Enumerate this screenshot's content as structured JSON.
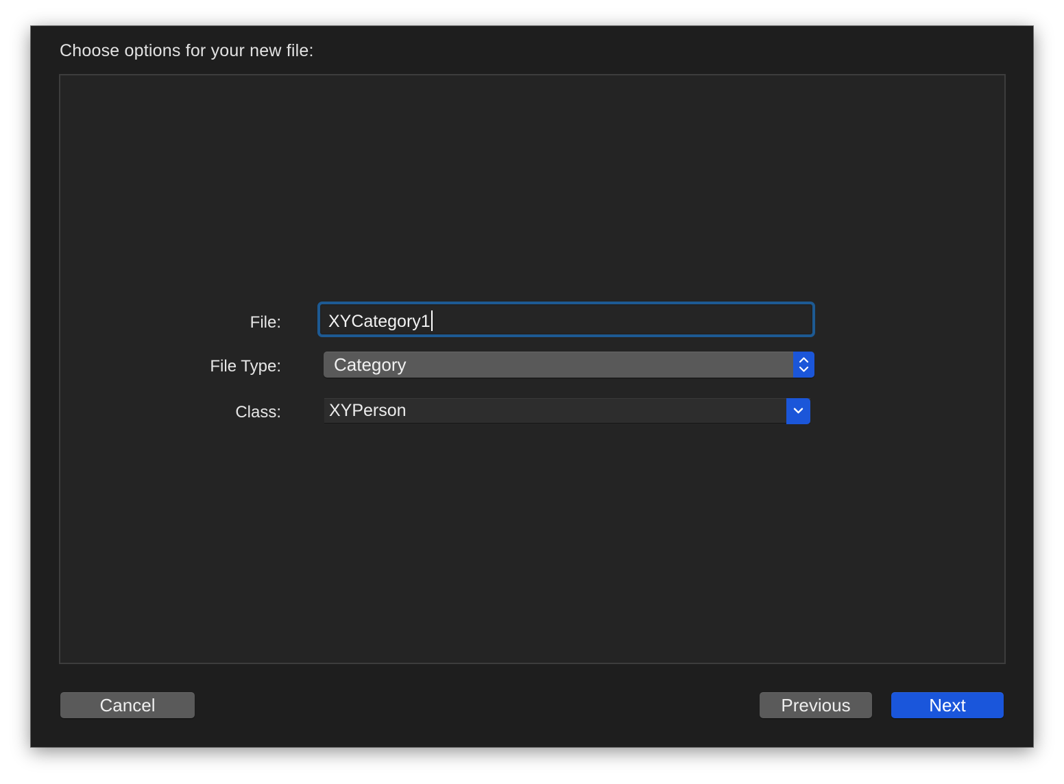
{
  "dialog": {
    "title": "Choose options for your new file:"
  },
  "form": {
    "file_label": "File:",
    "file_value": "XYCategory1",
    "file_type_label": "File Type:",
    "file_type_value": "Category",
    "class_label": "Class:",
    "class_value": "XYPerson"
  },
  "buttons": {
    "cancel": "Cancel",
    "previous": "Previous",
    "next": "Next"
  },
  "colors": {
    "accent": "#1a56db",
    "focus_ring": "#1d5a93",
    "sheet_bg": "#1e1e1e",
    "panel_bg": "#242424"
  },
  "icons": {
    "file_type_stepper": "chevron-up-down-icon",
    "class_dropdown": "chevron-down-icon"
  }
}
